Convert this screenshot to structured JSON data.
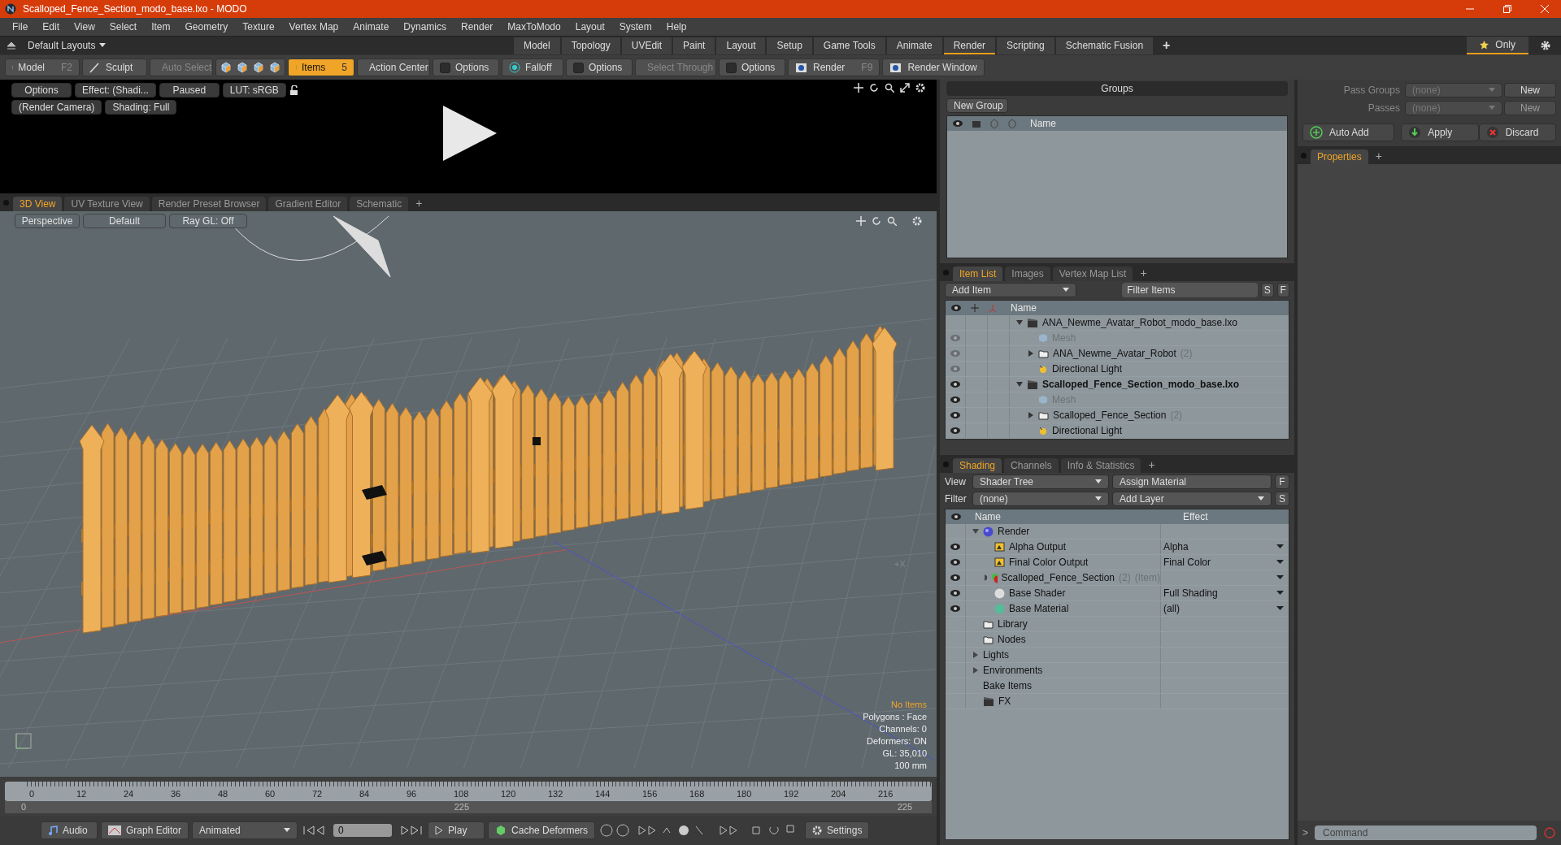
{
  "window": {
    "title": "Scalloped_Fence_Section_modo_base.lxo - MODO"
  },
  "menu": [
    "File",
    "Edit",
    "View",
    "Select",
    "Item",
    "Geometry",
    "Texture",
    "Vertex Map",
    "Animate",
    "Dynamics",
    "Render",
    "MaxToModo",
    "Layout",
    "System",
    "Help"
  ],
  "layouts": {
    "label": "Default Layouts",
    "add": "+",
    "only": "Only",
    "tabs": [
      {
        "label": "Model",
        "selected": false
      },
      {
        "label": "Topology",
        "selected": false
      },
      {
        "label": "UVEdit",
        "selected": false
      },
      {
        "label": "Paint",
        "selected": false
      },
      {
        "label": "Layout",
        "selected": false
      },
      {
        "label": "Setup",
        "selected": false
      },
      {
        "label": "Game Tools",
        "selected": false
      },
      {
        "label": "Animate",
        "selected": false
      },
      {
        "label": "Render",
        "selected": true
      },
      {
        "label": "Scripting",
        "selected": false
      },
      {
        "label": "Schematic Fusion",
        "selected": false
      }
    ]
  },
  "toolbar": [
    {
      "kind": "mode",
      "label": "Model",
      "shortcut": "F2",
      "selected": false,
      "disabled": false
    },
    {
      "kind": "sculpt",
      "label": "Sculpt",
      "selected": false,
      "disabled": false
    },
    {
      "kind": "autoselect",
      "label": "Auto Select",
      "selected": false,
      "disabled": true
    },
    {
      "kind": "selectors"
    },
    {
      "kind": "items",
      "label": "Items",
      "shortcut": "5",
      "selected": true,
      "disabled": false
    },
    {
      "kind": "center",
      "label": "Action Center",
      "selected": false,
      "disabled": false
    },
    {
      "kind": "options",
      "label": "Options",
      "selected": false,
      "disabled": false
    },
    {
      "kind": "falloff",
      "label": "Falloff",
      "selected": false,
      "disabled": false
    },
    {
      "kind": "options",
      "label": "Options",
      "selected": false,
      "disabled": false
    },
    {
      "kind": "through",
      "label": "Select Through",
      "selected": false,
      "disabled": true
    },
    {
      "kind": "options",
      "label": "Options",
      "selected": false,
      "disabled": false
    },
    {
      "kind": "render",
      "label": "Render",
      "shortcut": "F9",
      "selected": false,
      "disabled": false
    },
    {
      "kind": "renderwin",
      "label": "Render Window",
      "selected": false,
      "disabled": false
    }
  ],
  "render_preview": {
    "chips": [
      [
        "Options",
        "Effect: (Shadi...",
        "Paused",
        "LUT: sRGB"
      ],
      [
        "(Render Camera)",
        "Shading: Full"
      ]
    ]
  },
  "viewport_tabs": [
    {
      "label": "3D View",
      "selected": true
    },
    {
      "label": "UV Texture View",
      "selected": false
    },
    {
      "label": "Render Preset Browser",
      "selected": false
    },
    {
      "label": "Gradient Editor",
      "selected": false
    },
    {
      "label": "Schematic",
      "selected": false
    }
  ],
  "viewport_add": "+",
  "viewport": {
    "chips": [
      "Perspective",
      "Default",
      "Ray GL: Off"
    ],
    "axis_label": "+X",
    "hud": {
      "selection": "No Items",
      "lines": [
        "Polygons : Face",
        "Channels: 0",
        "Deformers: ON",
        "GL: 35,010",
        "100 mm"
      ]
    }
  },
  "timeline": {
    "ticks": [
      "0",
      "12",
      "24",
      "36",
      "48",
      "60",
      "72",
      "84",
      "96",
      "108",
      "120",
      "132",
      "144",
      "156",
      "168",
      "180",
      "192",
      "204",
      "216"
    ],
    "range_start": "0",
    "range_mid": "225",
    "range_end": "225"
  },
  "transport": {
    "audio": "Audio",
    "graph_editor": "Graph Editor",
    "mode": "Animated",
    "frame": "0",
    "play": "Play",
    "cache": "Cache Deformers",
    "settings": "Settings"
  },
  "groups": {
    "title": "Groups",
    "new_group": "New Group",
    "name_column": "Name"
  },
  "item_list": {
    "tabs": [
      {
        "label": "Item List",
        "selected": true
      },
      {
        "label": "Images",
        "selected": false
      },
      {
        "label": "Vertex Map List",
        "selected": false
      }
    ],
    "add": "+",
    "add_item": "Add Item",
    "filter_placeholder": "Filter Items",
    "s": "S",
    "f": "F",
    "name_column": "Name",
    "tree": [
      {
        "kind": "scene",
        "name": "ANA_Newme_Avatar_Robot_modo_base.lxo",
        "active": false,
        "expanded": true,
        "children": [
          {
            "kind": "mesh",
            "name": "Mesh",
            "visible": false
          },
          {
            "kind": "group",
            "name": "ANA_Newme_Avatar_Robot",
            "count": "(2)",
            "visible": false,
            "expanded": false
          },
          {
            "kind": "light",
            "name": "Directional Light",
            "visible": false
          }
        ]
      },
      {
        "kind": "scene",
        "name": "Scalloped_Fence_Section_modo_base.lxo",
        "active": true,
        "visible": true,
        "expanded": true,
        "children": [
          {
            "kind": "mesh",
            "name": "Mesh",
            "visible": true
          },
          {
            "kind": "group",
            "name": "Scalloped_Fence_Section",
            "count": "(2)",
            "visible": true,
            "expanded": false
          },
          {
            "kind": "light",
            "name": "Directional Light",
            "visible": true
          }
        ]
      }
    ]
  },
  "shading": {
    "tabs": [
      {
        "label": "Shading",
        "selected": true
      },
      {
        "label": "Channels",
        "selected": false
      },
      {
        "label": "Info & Statistics",
        "selected": false
      }
    ],
    "add": "+",
    "view_label": "View",
    "view": "Shader Tree",
    "assign": "Assign Material",
    "f": "F",
    "filter_label": "Filter",
    "filter": "(none)",
    "add_layer": "Add Layer",
    "s": "S",
    "columns": [
      "Name",
      "Effect"
    ],
    "tree": [
      {
        "kind": "render",
        "name": "Render",
        "expanded": true,
        "children": [
          {
            "kind": "output",
            "name": "Alpha Output",
            "effect": "Alpha",
            "visible": true
          },
          {
            "kind": "output",
            "name": "Final Color Output",
            "effect": "Final Color",
            "visible": true
          },
          {
            "kind": "matgroup",
            "name": "Scalloped_Fence_Section",
            "count": "(2)",
            "note": "(Item)",
            "visible": true,
            "expanded": false
          },
          {
            "kind": "shader",
            "name": "Base Shader",
            "effect": "Full Shading",
            "visible": true
          },
          {
            "kind": "material",
            "name": "Base Material",
            "effect": "(all)",
            "visible": true
          }
        ]
      },
      {
        "kind": "folder",
        "name": "Library"
      },
      {
        "kind": "folder",
        "name": "Nodes"
      },
      {
        "kind": "plain",
        "name": "Lights",
        "expanded": false
      },
      {
        "kind": "plain",
        "name": "Environments",
        "expanded": false
      },
      {
        "kind": "bake",
        "name": "Bake Items"
      },
      {
        "kind": "fx",
        "name": "FX"
      }
    ]
  },
  "passes": {
    "pass_groups_label": "Pass Groups",
    "pass_groups": "(none)",
    "new": "New",
    "passes_label": "Passes",
    "passes": "(none)",
    "new_passes": "New",
    "new_passes_disabled": true,
    "auto_add": "Auto Add",
    "apply": "Apply",
    "discard": "Discard"
  },
  "properties": {
    "tabs": [
      {
        "label": "Properties",
        "selected": true
      }
    ],
    "add": "+"
  },
  "command": {
    "prompt": ">",
    "placeholder": "Command"
  }
}
